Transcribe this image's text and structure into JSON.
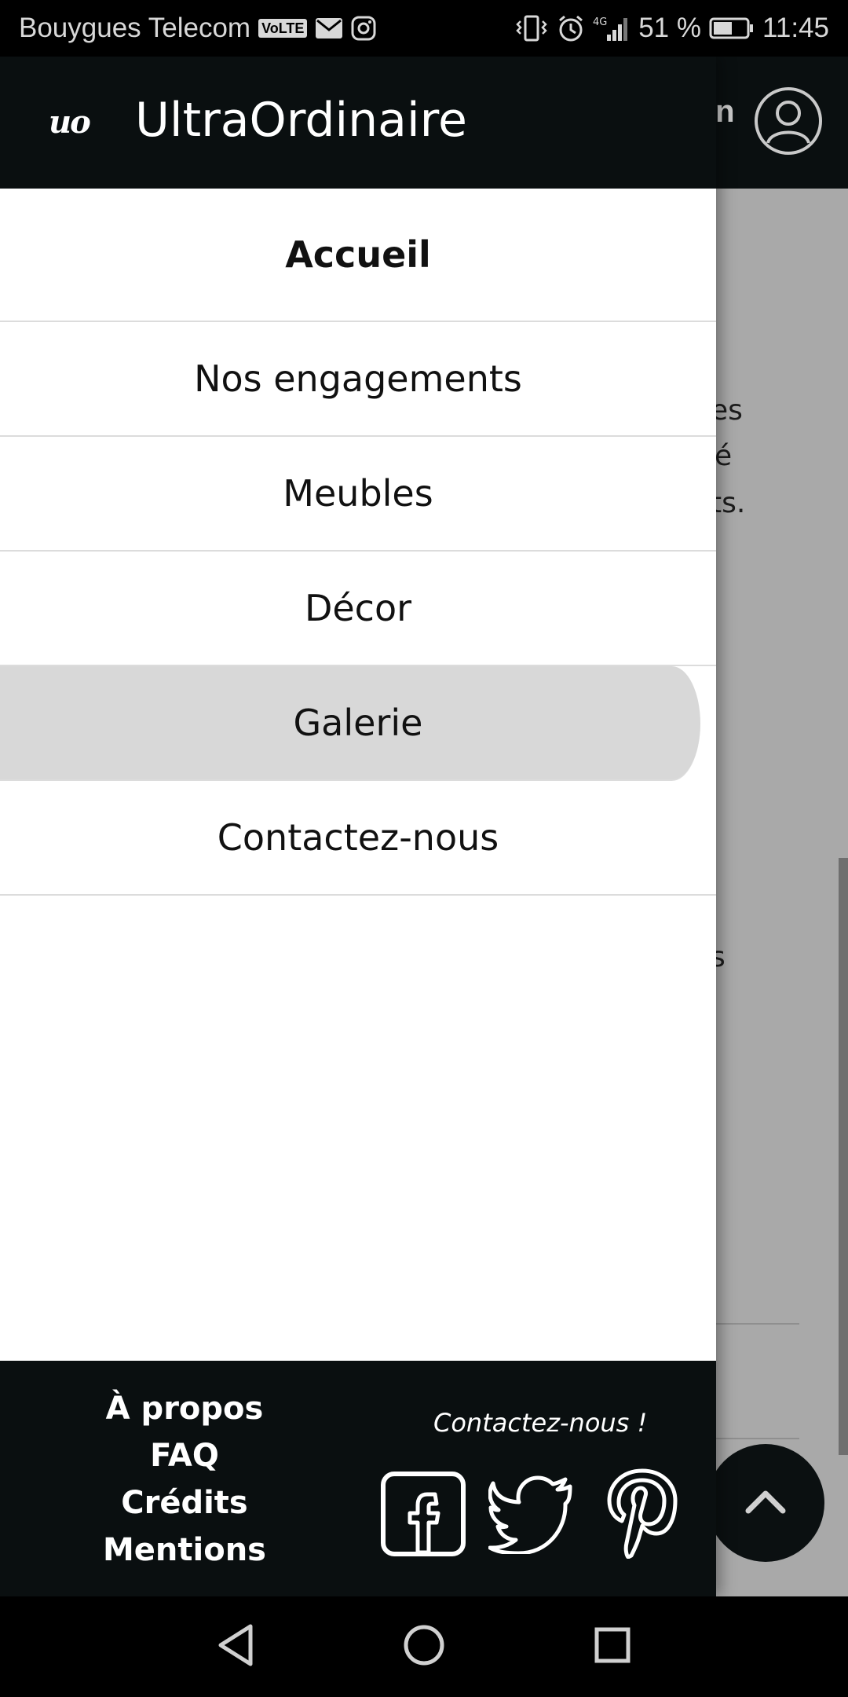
{
  "status_bar": {
    "carrier": "Bouygues Telecom",
    "volte": "VoLTE",
    "network": "4G",
    "battery": "51 %",
    "time": "11:45"
  },
  "app": {
    "brand_mark": "uo",
    "title": "UltraOrdinaire",
    "login_fragment": "in"
  },
  "menu": {
    "items": [
      {
        "label": "Accueil"
      },
      {
        "label": "Nos engagements"
      },
      {
        "label": "Meubles"
      },
      {
        "label": "Décor"
      },
      {
        "label": "Galerie"
      },
      {
        "label": "Contactez-nous"
      }
    ]
  },
  "background_fragments": {
    "line1": "es",
    "line2": "é",
    "line3": "ts.",
    "line4": "s"
  },
  "footer": {
    "links": [
      "À propos",
      "FAQ",
      "Crédits",
      "Mentions"
    ],
    "contact_label": "Contactez-nous !"
  }
}
